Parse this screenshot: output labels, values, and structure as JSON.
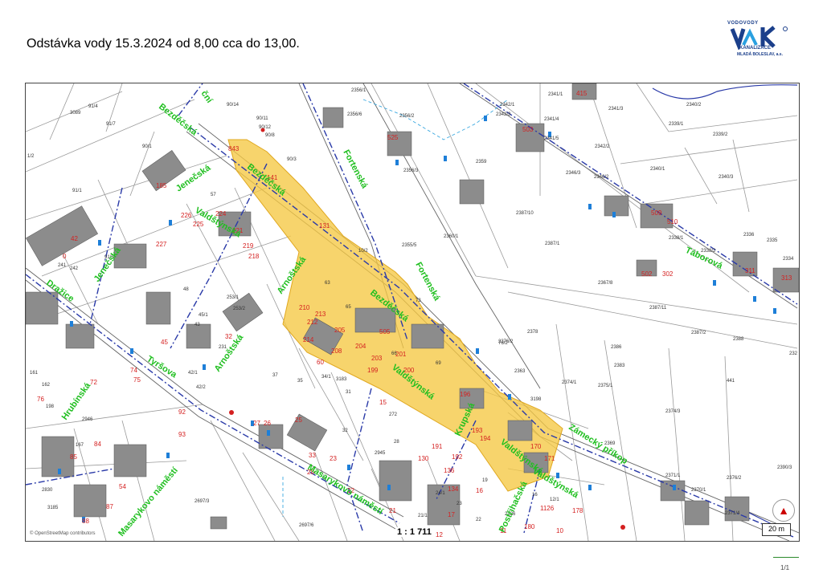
{
  "header": {
    "title": "Odstávka vody 15.3.2024     od 8,00 cca do 13,00."
  },
  "logo": {
    "top_text": "VODOVODY",
    "mark": "VaK",
    "line1": "KANALIZACE",
    "line2": "MLADÁ BOLESLAV, a.s."
  },
  "map": {
    "scale_ratio": "1 : 1 711",
    "scale_bar": "20 m",
    "attribution": "© OpenStreetMap contributors",
    "highlight_color": "#f5c842",
    "streets": [
      "Bezděčská",
      "Jenečská",
      "Valdštýnská",
      "Arnoštská",
      "Fortenská",
      "Táborová",
      "Jenečská",
      "Dražice",
      "Tyršova",
      "Hrubínská",
      "Masarykovo náměstí",
      "Masarykovo náměstí",
      "Krupská",
      "Zámecký příkop",
      "Valdštýnská",
      "Valdštýnská",
      "Arnoštská",
      "Bezděčská",
      "Fortenská",
      "Postřihačská",
      "Bezděčská",
      "ční",
      "Valdštýnská"
    ],
    "parcels": [
      "91/4",
      "3089",
      "91/7",
      "90/1",
      "91/1",
      "1/2",
      "57",
      "91/5",
      "90/14",
      "90/11",
      "90/12",
      "90/8",
      "90/3",
      "2356/1",
      "2356/6",
      "2356/2",
      "2356/3",
      "2359",
      "2387/10",
      "2360/1",
      "2355/5",
      "2342/1",
      "2342/3",
      "2341/1",
      "2341/4",
      "2341/5",
      "2341/3",
      "2342/2",
      "2346/3",
      "2346/2",
      "2339/1",
      "2339/2",
      "2340/1",
      "2340/3",
      "2340/2",
      "2387/1",
      "2338/1",
      "2338/2",
      "2336",
      "2335",
      "2334",
      "2367/8",
      "2387/11",
      "2387/2",
      "2388",
      "2386",
      "2383",
      "2378",
      "2376/2",
      "2363",
      "3198",
      "2374/1",
      "2375/1",
      "2374/3",
      "2369",
      "441",
      "2371/1",
      "2370/1",
      "2376/2",
      "2371/4",
      "2390/3",
      "232",
      "242",
      "241",
      "48",
      "253/1",
      "253/2",
      "45/1",
      "43",
      "231",
      "42/1",
      "42/2",
      "37",
      "35",
      "34/1",
      "31",
      "3183",
      "272",
      "28",
      "32",
      "2945",
      "161",
      "162",
      "198",
      "2946",
      "167",
      "2830",
      "3185",
      "2697/3",
      "2697/6",
      "24/1",
      "23",
      "22",
      "21/1",
      "19",
      "16",
      "2126",
      "12/1",
      "73",
      "63",
      "65",
      "66",
      "69",
      "76/2",
      "10/2",
      "66"
    ],
    "house_numbers": [
      "843",
      "185",
      "42",
      "0",
      "227",
      "226",
      "225",
      "224",
      "221",
      "219",
      "218",
      "60",
      "141",
      "131",
      "505",
      "502",
      "210",
      "213",
      "212",
      "214",
      "205",
      "204",
      "208",
      "203",
      "200",
      "201",
      "199",
      "196",
      "194",
      "193",
      "192",
      "191",
      "180",
      "178",
      "170",
      "171",
      "136",
      "130",
      "134",
      "45",
      "74",
      "75",
      "72",
      "76",
      "85",
      "84",
      "87",
      "88",
      "92",
      "93",
      "54",
      "33",
      "32",
      "25",
      "26",
      "27",
      "28",
      "23",
      "22",
      "21",
      "17",
      "16",
      "15",
      "12",
      "11",
      "10",
      "509",
      "510",
      "313",
      "311",
      "302",
      "1126",
      "415",
      "503",
      "525"
    ]
  },
  "footer": {
    "page": "1/1"
  }
}
